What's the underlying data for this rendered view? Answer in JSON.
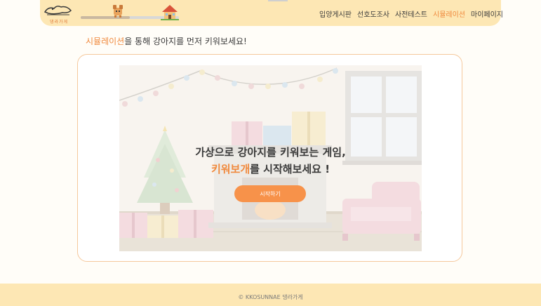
{
  "header": {
    "logo_text": "댕라가게",
    "progress": 0.5,
    "nav": [
      {
        "label": "입양게시판",
        "active": false
      },
      {
        "label": "선호도조사",
        "active": false
      },
      {
        "label": "사전테스트",
        "active": false
      },
      {
        "label": "시뮬레이션",
        "active": true
      },
      {
        "label": "마이페이지",
        "active": false
      }
    ]
  },
  "page_title": {
    "highlight": "시뮬레이션",
    "rest": "을 통해 강아지를 먼저 키워보세요!"
  },
  "card": {
    "headline_line1": "가상으로 강아지를 키워보는 게임,",
    "headline_highlight": "키워보개",
    "headline_line2_rest": "를 시작해보세요 !",
    "start_button": "시작하기"
  },
  "footer": {
    "copyright": "© KKOSUNNAE 댕라가게"
  },
  "colors": {
    "accent": "#f08a3e",
    "header_bg": "#fde7b4",
    "button": "#f7924a"
  }
}
